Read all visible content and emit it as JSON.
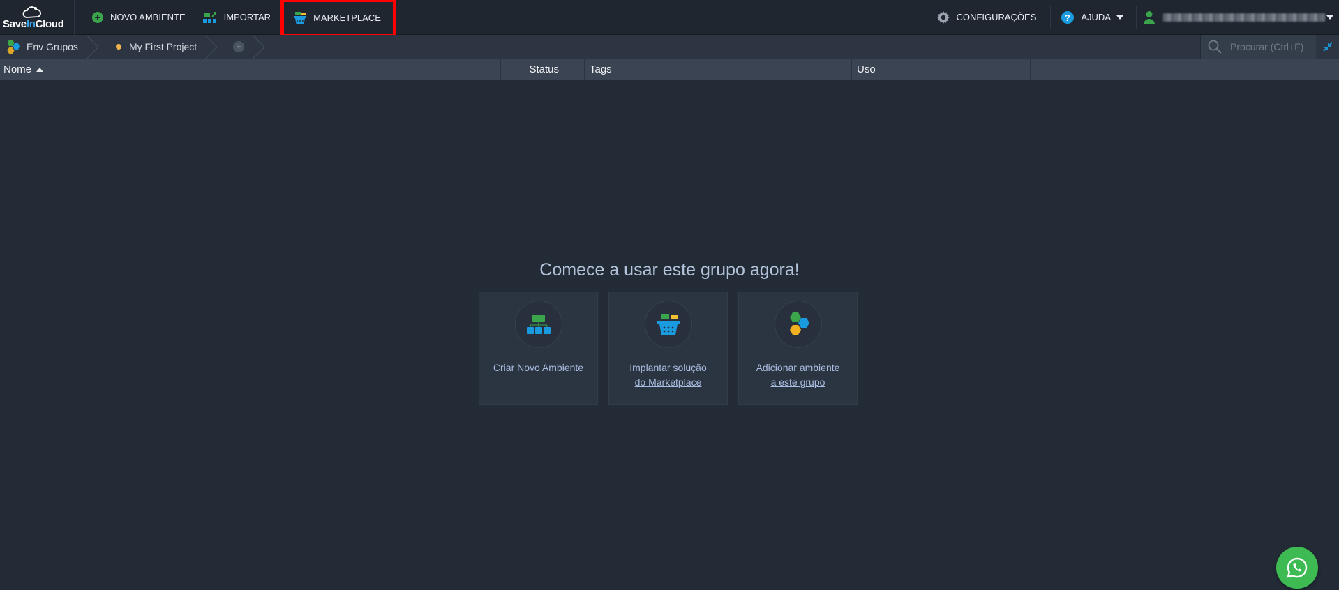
{
  "app": {
    "logo_text_pre": "Save",
    "logo_text_in": "In",
    "logo_text_post": "Cloud"
  },
  "topbar": {
    "new_env_label": "NOVO AMBIENTE",
    "import_label": "IMPORTAR",
    "marketplace_label": "MARKETPLACE",
    "settings_label": "CONFIGURAÇÕES",
    "help_label": "AJUDA"
  },
  "breadcrumb": {
    "groups_label": "Env Grupos",
    "project_label": "My First Project",
    "add_symbol": "+"
  },
  "search": {
    "placeholder": "Procurar (Ctrl+F)"
  },
  "table": {
    "columns": {
      "name": "Nome",
      "status": "Status",
      "tags": "Tags",
      "usage": "Uso"
    }
  },
  "empty_state": {
    "title": "Comece a usar este grupo agora!",
    "cards": [
      {
        "line1": "Criar Novo Ambiente",
        "line2": ""
      },
      {
        "line1": "Implantar solução",
        "line2": "do Marketplace"
      },
      {
        "line1": "Adicionar ambiente",
        "line2": "a este grupo"
      }
    ]
  },
  "colors": {
    "background": "#232b36",
    "topbar": "#1f2630",
    "highlight": "#ff0000",
    "accent_blue": "#1a9be0",
    "accent_green": "#3aa54a",
    "whatsapp": "#3dbb52"
  }
}
